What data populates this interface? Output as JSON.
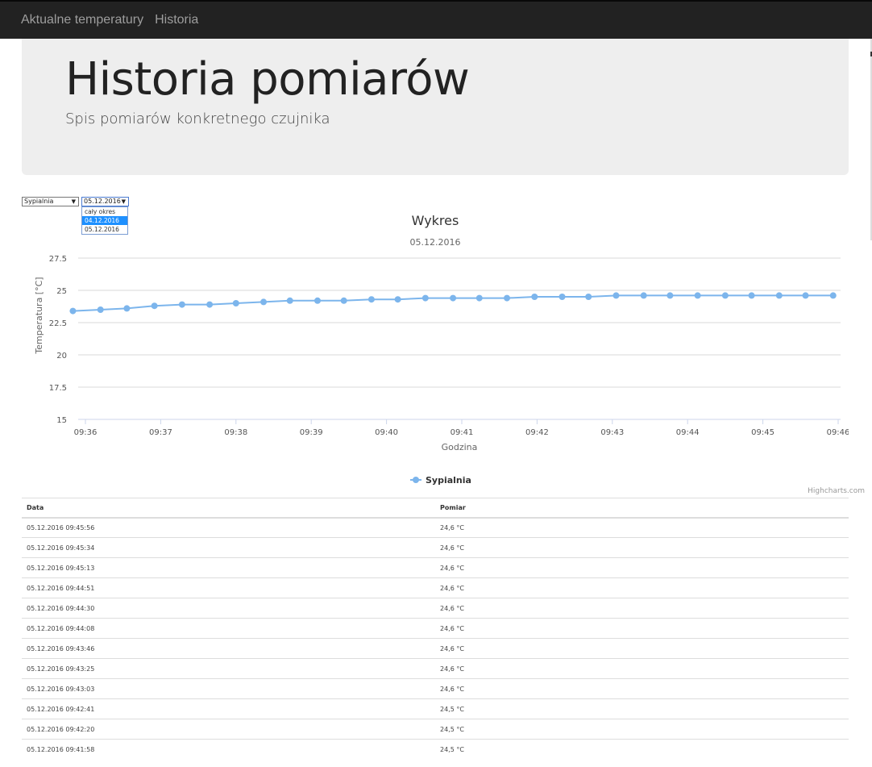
{
  "navbar": {
    "links": [
      "Aktualne temperatury",
      "Historia"
    ]
  },
  "jumbotron": {
    "title": "Historia pomiarów",
    "subtitle": "Spis pomiarów konkretnego czujnika"
  },
  "filters": {
    "sensor": {
      "selected": "Sypialnia"
    },
    "date": {
      "selected": "05.12.2016",
      "options": [
        "cały okres",
        "04.12.2016",
        "05.12.2016"
      ],
      "highlighted_option": "04.12.2016"
    }
  },
  "chart_data": {
    "type": "line",
    "title": "Wykres",
    "subtitle": "05.12.2016",
    "xlabel": "Godzina",
    "ylabel": "Temperatura [°C]",
    "ylim": [
      15,
      27.5
    ],
    "yticks": [
      "15",
      "17.5",
      "20",
      "22.5",
      "25",
      "27.5"
    ],
    "xticks": [
      "09:36",
      "09:37",
      "09:38",
      "09:39",
      "09:40",
      "09:41",
      "09:42",
      "09:43",
      "09:44",
      "09:45",
      "09:46"
    ],
    "grid": true,
    "legend_position": "bottom-center",
    "color": "#7cb5ec",
    "credits": "Highcharts.com",
    "series": [
      {
        "name": "Sypialnia",
        "x": [
          "09:35:50",
          "09:36:12",
          "09:36:33",
          "09:36:55",
          "09:37:17",
          "09:37:39",
          "09:38:00",
          "09:38:22",
          "09:38:43",
          "09:39:05",
          "09:39:26",
          "09:39:48",
          "09:40:09",
          "09:40:31",
          "09:40:53",
          "09:41:14",
          "09:41:36",
          "09:41:58",
          "09:42:20",
          "09:42:41",
          "09:43:03",
          "09:43:25",
          "09:43:46",
          "09:44:08",
          "09:44:30",
          "09:44:51",
          "09:45:13",
          "09:45:34",
          "09:45:56"
        ],
        "values": [
          23.4,
          23.5,
          23.6,
          23.8,
          23.9,
          23.9,
          24.0,
          24.1,
          24.2,
          24.2,
          24.2,
          24.3,
          24.3,
          24.4,
          24.4,
          24.4,
          24.4,
          24.5,
          24.5,
          24.5,
          24.6,
          24.6,
          24.6,
          24.6,
          24.6,
          24.6,
          24.6,
          24.6,
          24.6
        ]
      }
    ]
  },
  "table": {
    "headers": [
      "Data",
      "Pomiar"
    ],
    "rows": [
      [
        "05.12.2016 09:45:56",
        "24,6 °C"
      ],
      [
        "05.12.2016 09:45:34",
        "24,6 °C"
      ],
      [
        "05.12.2016 09:45:13",
        "24,6 °C"
      ],
      [
        "05.12.2016 09:44:51",
        "24,6 °C"
      ],
      [
        "05.12.2016 09:44:30",
        "24,6 °C"
      ],
      [
        "05.12.2016 09:44:08",
        "24,6 °C"
      ],
      [
        "05.12.2016 09:43:46",
        "24,6 °C"
      ],
      [
        "05.12.2016 09:43:25",
        "24,6 °C"
      ],
      [
        "05.12.2016 09:43:03",
        "24,6 °C"
      ],
      [
        "05.12.2016 09:42:41",
        "24,5 °C"
      ],
      [
        "05.12.2016 09:42:20",
        "24,5 °C"
      ],
      [
        "05.12.2016 09:41:58",
        "24,5 °C"
      ]
    ]
  }
}
